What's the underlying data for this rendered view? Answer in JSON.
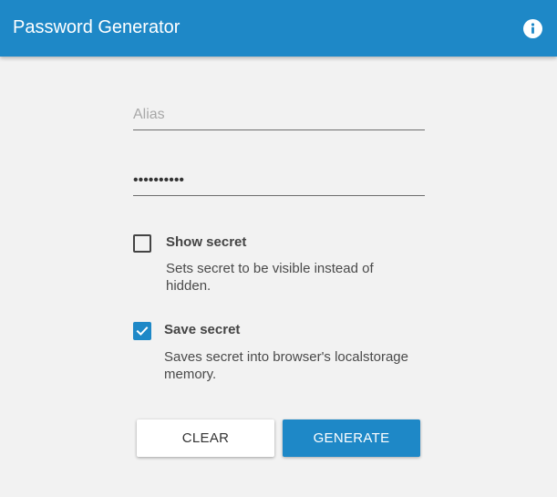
{
  "header": {
    "title": "Password Generator",
    "info_icon": "info-icon"
  },
  "form": {
    "alias": {
      "placeholder": "Alias",
      "value": ""
    },
    "secret": {
      "value": "••••••••••",
      "input_type": "password"
    },
    "show_secret": {
      "label": "Show secret",
      "description": "Sets secret to be visible instead of hidden.",
      "checked": false
    },
    "save_secret": {
      "label": "Save secret",
      "description": "Saves secret into browser's localstorage memory.",
      "checked": true
    }
  },
  "actions": {
    "clear_label": "CLEAR",
    "generate_label": "GENERATE"
  },
  "colors": {
    "primary": "#1e88c7",
    "background": "#f2f2f2"
  }
}
